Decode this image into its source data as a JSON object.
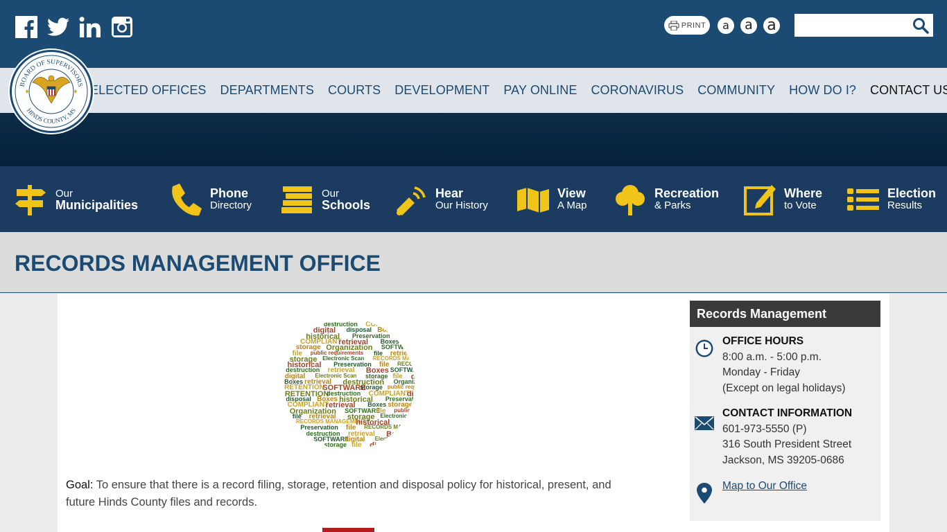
{
  "social": {
    "facebook": "facebook-icon",
    "twitter": "twitter-icon",
    "linkedin": "linkedin-icon",
    "instagram": "instagram-icon"
  },
  "tools": {
    "print_label": "PRINT",
    "font_small": "a",
    "font_medium": "a",
    "font_large": "a",
    "search_placeholder": ""
  },
  "seal": {
    "top_text": "BOARD OF SUPERVISORS",
    "bottom_text": "HINDS COUNTY, MS"
  },
  "nav": {
    "items": [
      {
        "label": "ELECTED OFFICES"
      },
      {
        "label": "DEPARTMENTS"
      },
      {
        "label": "COURTS"
      },
      {
        "label": "DEVELOPMENT"
      },
      {
        "label": "PAY ONLINE"
      },
      {
        "label": "CORONAVIRUS"
      },
      {
        "label": "COMMUNITY"
      },
      {
        "label": "HOW DO I?"
      },
      {
        "label": "CONTACT US"
      }
    ]
  },
  "quick_links": [
    {
      "line1": "Our",
      "line2": "Municipalities"
    },
    {
      "line1": "Phone",
      "line2": "Directory"
    },
    {
      "line1": "Our",
      "line2": "Schools"
    },
    {
      "line1": "Hear",
      "line2": "Our History"
    },
    {
      "line1": "View",
      "line2": "A Map"
    },
    {
      "line1": "Recreation",
      "line2": "& Parks"
    },
    {
      "line1": "Where",
      "line2": "to Vote"
    },
    {
      "line1": "Election",
      "line2": "Results"
    }
  ],
  "page": {
    "title": "RECORDS MANAGEMENT OFFICE",
    "goal_label": "Goal:",
    "goal_text": " To ensure that there is a record filing, storage, retention and disposal policy for historical, present, and future Hinds County files and records."
  },
  "wordcloud": {
    "words": [
      "destruction",
      "COMPLIANT",
      "digital",
      "disposal",
      "Boxes",
      "historical",
      "Preservation",
      "COMPLIANT",
      "retrieval",
      "Boxes",
      "storage",
      "Organization",
      "SOFTWARE",
      "file",
      "public requirements",
      "file",
      "retrieval",
      "storage",
      "Electronic Scan",
      "RECORDS MANAGEMENT",
      "historical",
      "Preservation",
      "file",
      "RECORDS MANAGEMENT",
      "destruction",
      "retrieval",
      "Boxes",
      "SOFTWARE",
      "digital",
      "Electronic Scan",
      "storage",
      "file",
      "disposal",
      "Boxes",
      "retrieval",
      "destruction",
      "Organization",
      "RETENTION",
      "SOFTWARE",
      "storage",
      "public requirements",
      "RETENTION"
    ]
  },
  "sidebar": {
    "title": "Records Management",
    "hours_heading": "OFFICE HOURS",
    "hours_line1": "8:00 a.m. - 5:00 p.m.",
    "hours_line2": "Monday - Friday",
    "hours_line3": "(Except on legal holidays)",
    "contact_heading": "CONTACT INFORMATION",
    "phone": "601-973-5550 (P)",
    "address1": "316 South President Street",
    "address2": "Jackson, MS 39205-0686",
    "map_link": "Map to Our Office"
  }
}
